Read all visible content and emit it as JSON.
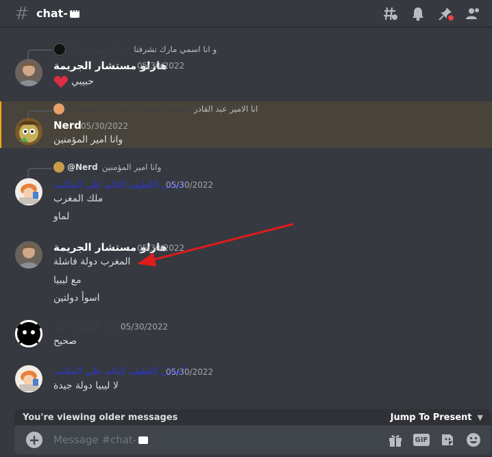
{
  "header": {
    "channel_name": "chat-",
    "icons": [
      "threads-icon",
      "bell-icon",
      "pin-icon",
      "members-icon"
    ]
  },
  "messages": [
    {
      "reply_text": "و انا اسمي مارك تشرفنا",
      "reply_name": "الملك فيصل الأول",
      "username": "هارلو مستشار الجريمة",
      "timestamp": "05/30/2022",
      "lines": [
        "حبيبي"
      ],
      "has_heart": true
    },
    {
      "reply_text": "انا الامير عبد القادر",
      "reply_name": "@الطفل اللطيف النائم على المكتب",
      "username": "Nerd",
      "timestamp": "05/30/2022",
      "lines": [
        "وانا امير المؤمنين"
      ],
      "highlighted": true
    },
    {
      "reply_text": "وانا امير المؤمنين",
      "reply_name": "@Nerd",
      "username": "الطفل اللطيف النائم على المكتب",
      "timestamp": "05/30/2022",
      "lines": [
        "ملك المغرب",
        "لماو"
      ]
    },
    {
      "username": "هارلو مستشار الجريمة",
      "timestamp": "05/30/2022",
      "lines": [
        "المغرب دولة فاشلة",
        "مع ليبيا",
        "اسوأ دولتين"
      ]
    },
    {
      "username": "الملك فيصل الأول",
      "timestamp": "05/30/2022",
      "lines": [
        "صحيح"
      ]
    },
    {
      "username": "الطفل اللطيف النائم على المكتب",
      "timestamp": "05/30/2022",
      "lines": [
        "لا ليبيا دولة جيدة"
      ]
    }
  ],
  "banner": {
    "older_text": "You're viewing older messages",
    "jump_label": "Jump To Present"
  },
  "composer": {
    "placeholder": "Message #chat-",
    "gif_label": "GIF"
  },
  "colors": {
    "background": "#36393f",
    "highlight_border": "#faa61a",
    "arrow": "#e01b1b",
    "blue_name": "#2b35d4"
  }
}
